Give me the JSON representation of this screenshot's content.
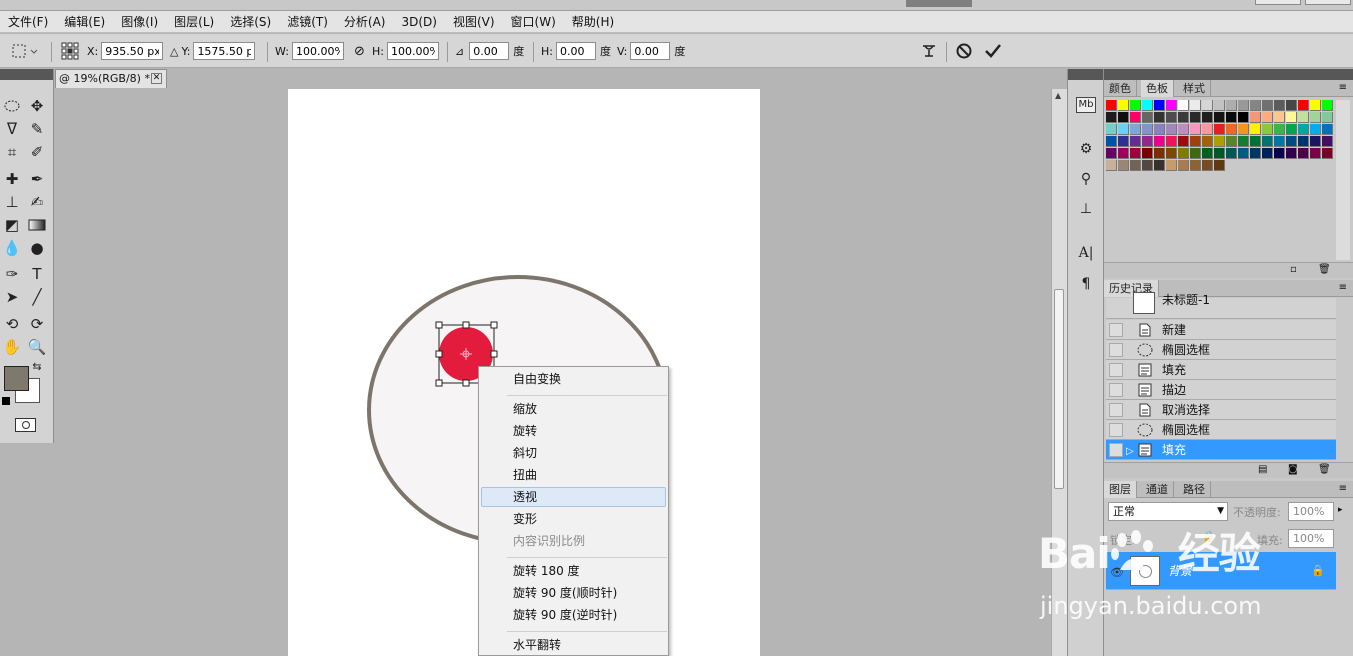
{
  "menu": [
    "文件(F)",
    "编辑(E)",
    "图像(I)",
    "图层(L)",
    "选择(S)",
    "滤镜(T)",
    "分析(A)",
    "3D(D)",
    "视图(V)",
    "窗口(W)",
    "帮助(H)"
  ],
  "options": {
    "x_label": "X:",
    "x_value": "935.50 px",
    "y_label": "Y:",
    "y_value": "1575.50 px",
    "w_label": "W:",
    "w_value": "100.00%",
    "h_label": "H:",
    "h_value": "100.00%",
    "angle_value": "0.00",
    "angle_unit": "度",
    "skew_h_label": "H:",
    "skew_h_value": "0.00",
    "skew_h_unit": "度",
    "skew_v_label": "V:",
    "skew_v_value": "0.00",
    "skew_v_unit": "度"
  },
  "document": {
    "tab_title": "@ 19%(RGB/8) *"
  },
  "context_menu": {
    "items": [
      "自由变换",
      "缩放",
      "旋转",
      "斜切",
      "扭曲",
      "透视",
      "变形",
      "内容识别比例",
      "旋转 180 度",
      "旋转 90 度(顺时针)",
      "旋转 90 度(逆时针)",
      "水平翻转"
    ],
    "highlighted": "透视",
    "disabled": "内容识别比例"
  },
  "swatches_panel": {
    "tabs": [
      "颜色",
      "色板",
      "样式"
    ],
    "active": "色板"
  },
  "history_panel": {
    "title": "历史记录",
    "snapshot": "未标题-1",
    "items": [
      {
        "label": "新建",
        "icon": "doc-icon"
      },
      {
        "label": "椭圆选框",
        "icon": "ellipse-marquee-icon"
      },
      {
        "label": "填充",
        "icon": "fill-icon"
      },
      {
        "label": "描边",
        "icon": "fill-icon"
      },
      {
        "label": "取消选择",
        "icon": "doc-icon"
      },
      {
        "label": "椭圆选框",
        "icon": "ellipse-marquee-icon"
      },
      {
        "label": "填充",
        "icon": "fill-icon"
      }
    ],
    "selected_index": 6
  },
  "layers_panel": {
    "tabs": [
      "图层",
      "通道",
      "路径"
    ],
    "blend_mode": "正常",
    "opacity_label": "不透明度:",
    "opacity_value": "100%",
    "lock_label": "锁定:",
    "fill_label": "填充:",
    "fill_value": "100%",
    "layer_name": "背景"
  },
  "colors": {
    "foreground": "#7f786d",
    "background": "#ffffff",
    "red_circle": "#e31b3c",
    "ellipse_stroke": "#7d756b",
    "ellipse_fill": "#f6f4f5",
    "selection": "#3399ff"
  },
  "watermark": {
    "brand": "Bai",
    "paw": "du",
    "jingyan": "经验",
    "url": "jingyan.baidu.com"
  }
}
